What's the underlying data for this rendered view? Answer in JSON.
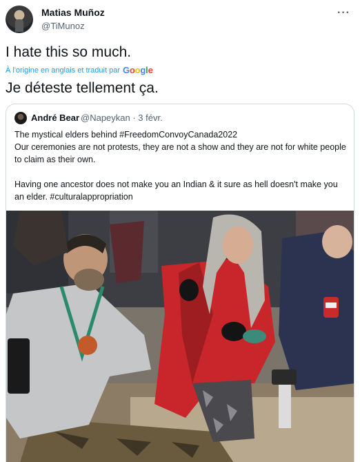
{
  "author": {
    "name": "Matias Muñoz",
    "handle": "@TiMunoz",
    "more_icon": "more-horizontal-icon"
  },
  "tweet": {
    "original_text": "I hate this so much.",
    "translation_notice": "À l'origine en anglais et traduit par",
    "translation_provider": "Google",
    "translated_text": "Je déteste tellement ça."
  },
  "quoted": {
    "name": "André Bear",
    "handle_date": "@Napeykan · 3 févr.",
    "line1": "The mystical elders behind #FreedomConvoyCanada2022",
    "line2": "Our ceremonies are not protests, they are not a show and they are not for white people to claim as their own.",
    "line3": "Having one ancestor does not make you an Indian & it sure as hell doesn't make you an elder. #culturalappropriation"
  },
  "colors": {
    "link": "#1d9bf0",
    "secondary_text": "#536471",
    "border": "#cfd9de",
    "jacket_red": "#c8262b"
  }
}
